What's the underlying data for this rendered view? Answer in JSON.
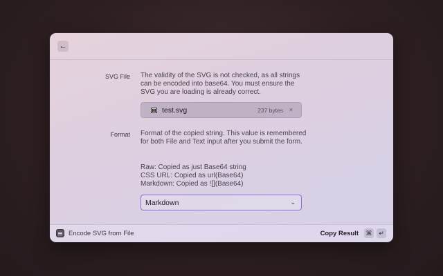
{
  "topbar": {
    "back_icon": "←"
  },
  "svg_file": {
    "label": "SVG File",
    "description": "The validity of the SVG is not checked, as all strings can be encoded into base64. You must ensure the SVG you are loading is already correct.",
    "file": {
      "name": "test.svg",
      "size": "237 bytes",
      "remove_icon": "×"
    }
  },
  "format": {
    "label": "Format",
    "description": "Format of the copied string. This value is remembered for both File and Text input after you submit the form.",
    "options_help": [
      "Raw: Copied as just Base64 string",
      "CSS URL: Copied as url(Base64)",
      "Markdown: Copied as ![](Base64)"
    ],
    "selected": "Markdown",
    "chevron_icon": "⌄"
  },
  "bottombar": {
    "command_title": "Encode SVG from File",
    "primary_action": "Copy Result",
    "shortcut_cmd": "⌘",
    "shortcut_enter": "↵"
  },
  "colors": {
    "accent": "#8a6cd6"
  }
}
